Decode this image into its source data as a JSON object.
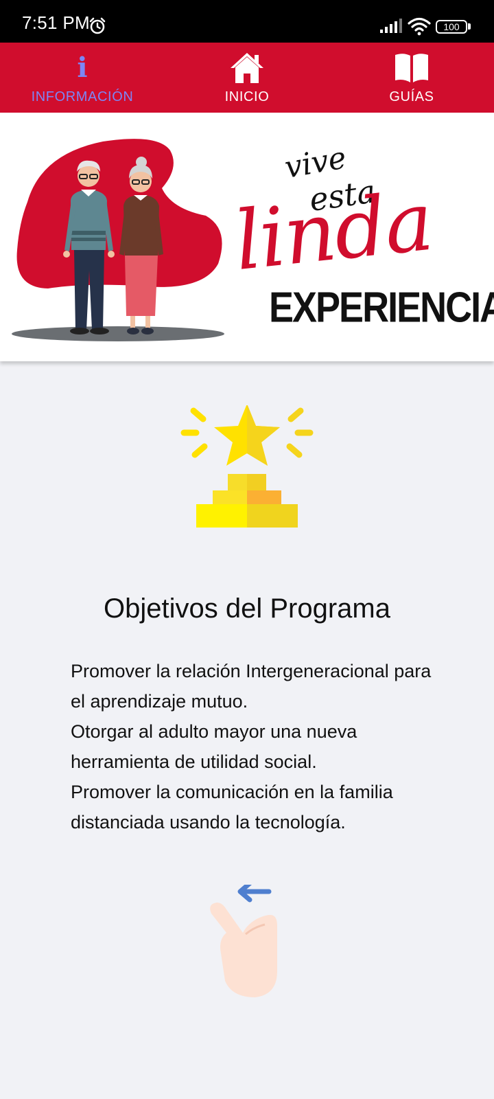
{
  "status_bar": {
    "time": "7:51 PM",
    "battery": "100"
  },
  "nav": {
    "items": [
      {
        "label": "INFORMACIÓN",
        "icon": "info-icon",
        "active": true
      },
      {
        "label": "INICIO",
        "icon": "home-icon",
        "active": false
      },
      {
        "label": "GUÍAS",
        "icon": "book-icon",
        "active": false
      }
    ],
    "accent_color": "#d00d2d",
    "active_color": "#7d86f4"
  },
  "banner": {
    "slogan": {
      "line1": "vive",
      "line2": "esta",
      "line3": "linda",
      "line4": "EXPERIENCIA!"
    }
  },
  "content": {
    "title": "Objetivos del Programa",
    "objectives": [
      "Promover la relación Intergeneracional para el aprendizaje mutuo.",
      "Otorgar al adulto mayor una nueva herramienta de utilidad social.",
      "Promover la comunicación en la familia distanciada usando la tecnología."
    ]
  }
}
